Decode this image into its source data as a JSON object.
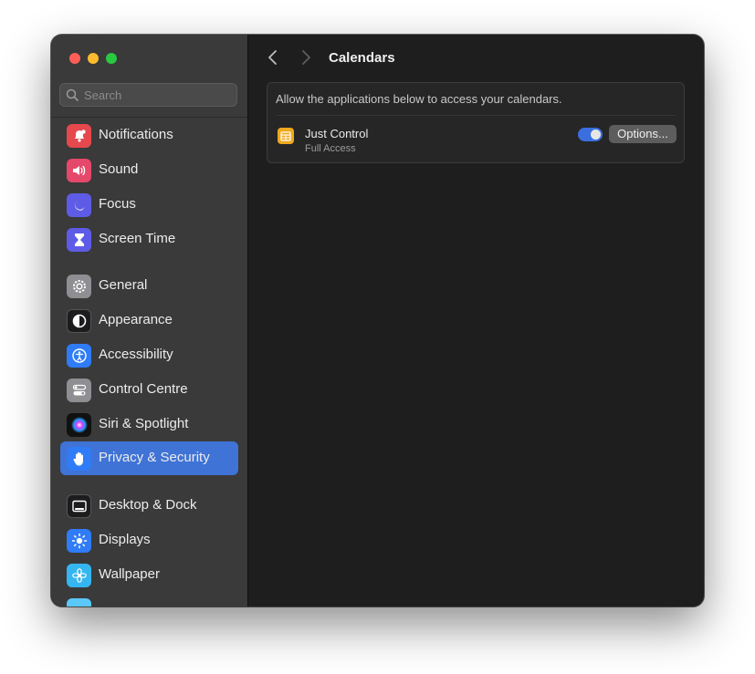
{
  "search": {
    "placeholder": "Search"
  },
  "sidebar": {
    "items": [
      {
        "label": "Notifications"
      },
      {
        "label": "Sound"
      },
      {
        "label": "Focus"
      },
      {
        "label": "Screen Time"
      },
      {
        "label": "General"
      },
      {
        "label": "Appearance"
      },
      {
        "label": "Accessibility"
      },
      {
        "label": "Control Centre"
      },
      {
        "label": "Siri & Spotlight"
      },
      {
        "label": "Privacy & Security",
        "selected": true
      },
      {
        "label": "Desktop & Dock"
      },
      {
        "label": "Displays"
      },
      {
        "label": "Wallpaper"
      }
    ]
  },
  "header": {
    "title": "Calendars"
  },
  "main": {
    "description": "Allow the applications below to access your calendars.",
    "apps": [
      {
        "name": "Just Control",
        "access": "Full Access",
        "enabled": true,
        "options_label": "Options..."
      }
    ]
  },
  "colors": {
    "accent": "#3f73d6",
    "toggle_on": "#3b6fe0"
  }
}
